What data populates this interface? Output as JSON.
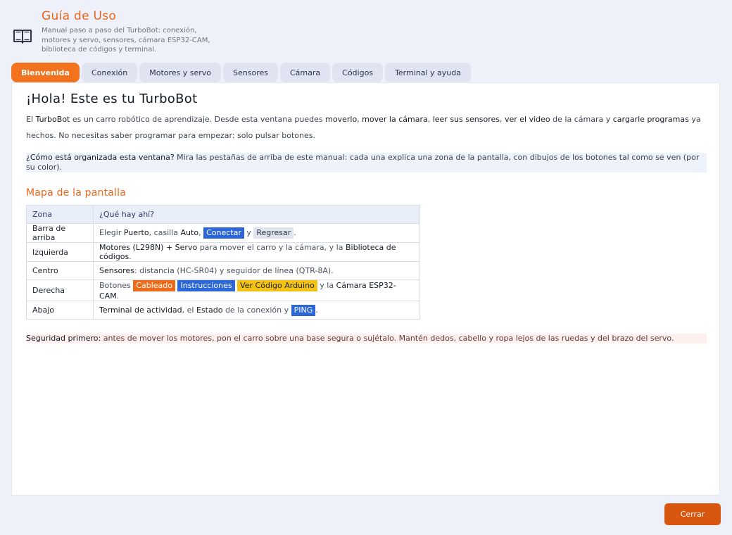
{
  "header": {
    "title": "Guía de Uso",
    "subtitle": "Manual paso a paso del TurboBot: conexión, motores y servo, sensores, cámara ESP32-CAM, biblioteca de códigos y terminal.",
    "icon": "book-icon"
  },
  "tabs": [
    {
      "label": "Bienvenida",
      "active": true
    },
    {
      "label": "Conexión"
    },
    {
      "label": "Motores y servo"
    },
    {
      "label": "Sensores"
    },
    {
      "label": "Cámara"
    },
    {
      "label": "Códigos"
    },
    {
      "label": "Terminal y ayuda"
    }
  ],
  "welcome": {
    "heading": "¡Hola! Este es tu TurboBot",
    "intro": {
      "t1": "El ",
      "b1": "TurboBot",
      "t2": " es un carro robótico de aprendizaje. Desde esta ventana puedes ",
      "b2": "moverlo",
      "t3": ", ",
      "b3": "mover la cámara",
      "t4": ", ",
      "b4": "leer sus sensores",
      "t5": ", ",
      "b5": "ver el video",
      "t6": " de la cámara y ",
      "b6": "cargarle programas",
      "t7": " ya hechos. No necesitas saber programar para empezar: solo pulsar botones."
    },
    "organized": {
      "question": "¿Cómo está organizada esta ventana?",
      "text": " Mira las pestañas de arriba de este manual: cada una explica una zona de la pantalla, con dibujos de los botones tal como se ven (por su color)."
    },
    "map_heading": "Mapa de la pantalla",
    "table": {
      "col_zone": "Zona",
      "col_what": "¿Qué hay ahí?",
      "rows": {
        "top": {
          "zone": "Barra de arriba",
          "t1": "Elegir ",
          "s1": "Puerto",
          "t2": ", casilla ",
          "s2": "Auto",
          "t3": ", ",
          "chip1": "Conectar",
          "t4": " y ",
          "chip2": "Regresar",
          "t5": "."
        },
        "left": {
          "zone": "Izquierda",
          "s1": "Motores (L298N) + Servo",
          "t1": " para mover el carro y la cámara, y la ",
          "s2": "Biblioteca de códigos",
          "t2": "."
        },
        "center": {
          "zone": "Centro",
          "s1": "Sensores",
          "t1": ": distancia (HC-SR04) y seguidor de línea (QTR-8A)."
        },
        "right": {
          "zone": "Derecha",
          "t1": "Botones ",
          "chip1": "Cableado",
          "t2": " ",
          "chip2": "Instrucciones",
          "t3": " ",
          "chip3": "Ver Código Arduino",
          "t4": " y la ",
          "s1": "Cámara ESP32-CAM",
          "t5": "."
        },
        "bottom": {
          "zone": "Abajo",
          "s1": "Terminal de actividad",
          "t1": ", el ",
          "s2": "Estado",
          "t2": " de la conexión y ",
          "chip1": "PING",
          "t3": "."
        }
      }
    },
    "safety": {
      "label": "Seguridad primero:",
      "text": " antes de mover los motores, pon el carro sobre una base segura o sujétalo. Mantén dedos, cabello y ropa lejos de las ruedas y del brazo del servo."
    }
  },
  "footer": {
    "close_label": "Cerrar"
  },
  "colors": {
    "accent": "#f2721d",
    "close": "#d9560f",
    "chip_blue": "#2b67d8",
    "chip_orange": "#ee6b1c",
    "chip_yellow": "#f3c212"
  }
}
